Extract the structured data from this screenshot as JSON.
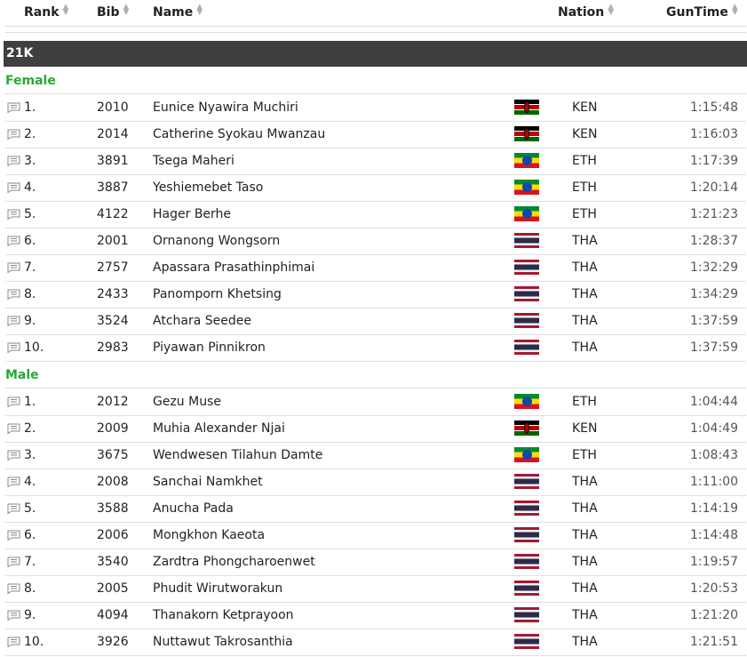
{
  "columns": {
    "rank": "Rank",
    "bib": "Bib",
    "name": "Name",
    "nation": "Nation",
    "guntime": "GunTime"
  },
  "section": "21K",
  "groups": [
    {
      "label": "Female",
      "rows": [
        {
          "rank": "1.",
          "bib": "2010",
          "name": "Eunice Nyawira Muchiri",
          "flag": "ken",
          "nation": "KEN",
          "time": "1:15:48"
        },
        {
          "rank": "2.",
          "bib": "2014",
          "name": "Catherine Syokau Mwanzau",
          "flag": "ken",
          "nation": "KEN",
          "time": "1:16:03"
        },
        {
          "rank": "3.",
          "bib": "3891",
          "name": "Tsega Maheri",
          "flag": "eth",
          "nation": "ETH",
          "time": "1:17:39"
        },
        {
          "rank": "4.",
          "bib": "3887",
          "name": "Yeshiemebet Taso",
          "flag": "eth",
          "nation": "ETH",
          "time": "1:20:14"
        },
        {
          "rank": "5.",
          "bib": "4122",
          "name": "Hager Berhe",
          "flag": "eth",
          "nation": "ETH",
          "time": "1:21:23"
        },
        {
          "rank": "6.",
          "bib": "2001",
          "name": "Ornanong Wongsorn",
          "flag": "tha",
          "nation": "THA",
          "time": "1:28:37"
        },
        {
          "rank": "7.",
          "bib": "2757",
          "name": "Apassara Prasathinphimai",
          "flag": "tha",
          "nation": "THA",
          "time": "1:32:29"
        },
        {
          "rank": "8.",
          "bib": "2433",
          "name": "Panomporn Khetsing",
          "flag": "tha",
          "nation": "THA",
          "time": "1:34:29"
        },
        {
          "rank": "9.",
          "bib": "3524",
          "name": "Atchara Seedee",
          "flag": "tha",
          "nation": "THA",
          "time": "1:37:59"
        },
        {
          "rank": "10.",
          "bib": "2983",
          "name": "Piyawan Pinnikron",
          "flag": "tha",
          "nation": "THA",
          "time": "1:37:59"
        }
      ]
    },
    {
      "label": "Male",
      "rows": [
        {
          "rank": "1.",
          "bib": "2012",
          "name": "Gezu Muse",
          "flag": "eth",
          "nation": "ETH",
          "time": "1:04:44"
        },
        {
          "rank": "2.",
          "bib": "2009",
          "name": "Muhia Alexander Njai",
          "flag": "ken",
          "nation": "KEN",
          "time": "1:04:49"
        },
        {
          "rank": "3.",
          "bib": "3675",
          "name": "Wendwesen Tilahun Damte",
          "flag": "eth",
          "nation": "ETH",
          "time": "1:08:43"
        },
        {
          "rank": "4.",
          "bib": "2008",
          "name": "Sanchai Namkhet",
          "flag": "tha",
          "nation": "THA",
          "time": "1:11:00"
        },
        {
          "rank": "5.",
          "bib": "3588",
          "name": "Anucha Pada",
          "flag": "tha",
          "nation": "THA",
          "time": "1:14:19"
        },
        {
          "rank": "6.",
          "bib": "2006",
          "name": "Mongkhon Kaeota",
          "flag": "tha",
          "nation": "THA",
          "time": "1:14:48"
        },
        {
          "rank": "7.",
          "bib": "3540",
          "name": "Zardtra Phongcharoenwet",
          "flag": "tha",
          "nation": "THA",
          "time": "1:19:57"
        },
        {
          "rank": "8.",
          "bib": "2005",
          "name": "Phudit Wirutworakun",
          "flag": "tha",
          "nation": "THA",
          "time": "1:20:53"
        },
        {
          "rank": "9.",
          "bib": "4094",
          "name": "Thanakorn Ketprayoon",
          "flag": "tha",
          "nation": "THA",
          "time": "1:21:20"
        },
        {
          "rank": "10.",
          "bib": "3926",
          "name": "Nuttawut Takrosanthia",
          "flag": "tha",
          "nation": "THA",
          "time": "1:21:51"
        }
      ]
    }
  ]
}
